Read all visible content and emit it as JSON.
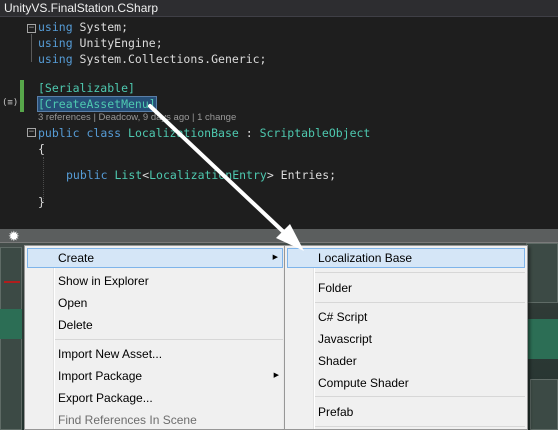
{
  "window": {
    "title": "UnityVS.FinalStation.CSharp"
  },
  "code": {
    "using1_kw": "using",
    "using1_ns": " System;",
    "using2_kw": "using",
    "using2_ns": " UnityEngine;",
    "using3_kw": "using",
    "using3_ns": " System.Collections.Generic;",
    "attr1": "[Serializable]",
    "attr2": "[CreateAssetMenu]",
    "codelens": "3 references | Deadcow, 9 days ago | 1 change",
    "class_public": "public",
    "class_kw": " class ",
    "class_name": "LocalizationBase",
    "class_colon": " : ",
    "class_base": "ScriptableObject",
    "brace_open": "{",
    "field_public": "public",
    "field_type": "List",
    "field_lt": "<",
    "field_arg": "LocalizationEntry",
    "field_rest": "> Entries;",
    "brace_close": "}",
    "fold_minus": "−",
    "gutter_glyph": "(≡)"
  },
  "context_menu": {
    "items": [
      {
        "label": "Create",
        "submenu": true
      },
      {
        "label": "Show in Explorer"
      },
      {
        "label": "Open"
      },
      {
        "label": "Delete"
      },
      {
        "label": "Import New Asset..."
      },
      {
        "label": "Import Package",
        "submenu": true
      },
      {
        "label": "Export Package..."
      },
      {
        "label": "Find References In Scene"
      }
    ],
    "submenu_arrow": "▶"
  },
  "create_submenu": {
    "items": [
      {
        "label": "Localization Base"
      },
      {
        "label": "Folder"
      },
      {
        "label": "C# Script"
      },
      {
        "label": "Javascript"
      },
      {
        "label": "Shader"
      },
      {
        "label": "Compute Shader"
      },
      {
        "label": "Prefab"
      }
    ]
  },
  "scene": {
    "sun_icon": "✹"
  },
  "colors": {
    "keyword": "#569cd6",
    "type": "#4ec9b0",
    "selection": "#264f78",
    "menu_highlight": "#d5e6f7",
    "arrow": "#ffffff"
  }
}
